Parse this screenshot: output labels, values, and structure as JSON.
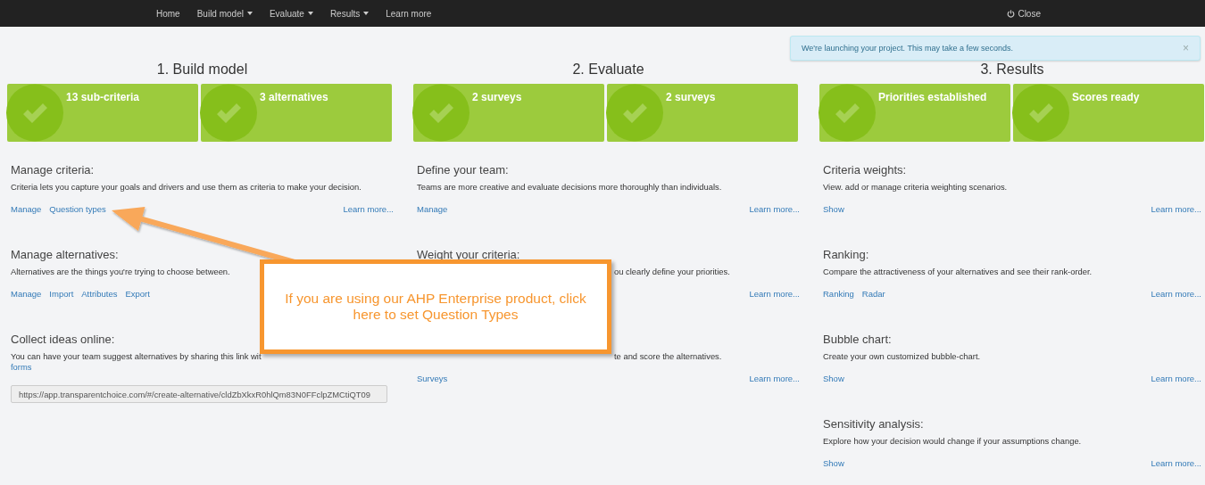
{
  "nav": {
    "items": [
      {
        "label": "Home",
        "dropdown": false
      },
      {
        "label": "Build model",
        "dropdown": true
      },
      {
        "label": "Evaluate",
        "dropdown": true
      },
      {
        "label": "Results",
        "dropdown": true
      },
      {
        "label": "Learn more",
        "dropdown": false
      }
    ],
    "close": "Close"
  },
  "toast": {
    "message": "We're launching your project. This may take a few seconds.",
    "close": "×"
  },
  "columns": [
    {
      "title": "1. Build model",
      "tiles": [
        {
          "label": "13 sub-criteria",
          "done": true
        },
        {
          "label": "3 alternatives",
          "done": true
        }
      ],
      "sections": [
        {
          "kind": "full",
          "heading": "Manage criteria:",
          "description": "Criteria lets you capture your goals and drivers and use them as criteria to make your decision.",
          "links": [
            "Manage",
            "Question types"
          ],
          "learn_more": "Learn more..."
        },
        {
          "kind": "full",
          "heading": "Manage alternatives:",
          "description": "Alternatives are the things you're trying to choose between.",
          "links": [
            "Manage",
            "Import",
            "Attributes",
            "Export"
          ]
        },
        {
          "kind": "full",
          "heading": "Collect ideas online:",
          "description": "You can have your team suggest alternatives by sharing this link wit",
          "inline_link": "forms",
          "url": "https://app.transparentchoice.com/#/create-alternative/cldZbXkxR0hlQm83N0FFclpZMCtiQT09"
        }
      ]
    },
    {
      "title": "2. Evaluate",
      "tiles": [
        {
          "label": "2 surveys",
          "done": true
        },
        {
          "label": "2 surveys",
          "done": true
        }
      ],
      "sections": [
        {
          "kind": "full",
          "heading": "Define your team:",
          "description": "Teams are more creative and evaluate decisions more thoroughly than individuals.",
          "links": [
            "Manage"
          ],
          "learn_more": "Learn more..."
        },
        {
          "kind": "covered",
          "heading": "Weight your criteria:",
          "description": "ou clearly define your priorities.",
          "learn_more": "Learn more..."
        },
        {
          "kind": "covered",
          "description": "te and score the alternatives.",
          "links": [
            "Surveys"
          ],
          "learn_more": "Learn more..."
        }
      ]
    },
    {
      "title": "3. Results",
      "tiles": [
        {
          "label": "Priorities established",
          "done": true
        },
        {
          "label": "Scores ready",
          "done": true
        }
      ],
      "sections": [
        {
          "kind": "full",
          "heading": "Criteria weights:",
          "description": "View. add or manage criteria weighting scenarios.",
          "links": [
            "Show"
          ],
          "learn_more": "Learn more..."
        },
        {
          "kind": "full",
          "heading": "Ranking:",
          "description": "Compare the attractiveness of your alternatives and see their rank-order.",
          "links": [
            "Ranking",
            "Radar"
          ],
          "learn_more": "Learn more..."
        },
        {
          "kind": "full",
          "heading": "Bubble chart:",
          "description": "Create your own customized bubble-chart.",
          "links": [
            "Show"
          ],
          "learn_more": "Learn more..."
        },
        {
          "kind": "full",
          "heading": "Sensitivity analysis:",
          "description": "Explore how your decision would change if your assumptions change.",
          "links": [
            "Show"
          ],
          "learn_more": "Learn more..."
        }
      ]
    }
  ],
  "callout": {
    "text": "If you are using our AHP Enterprise product, click here to set Question Types"
  }
}
